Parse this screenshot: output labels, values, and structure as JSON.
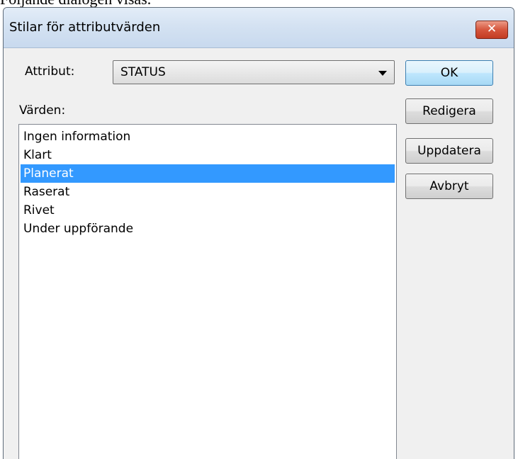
{
  "document_text": "Följande dialogen visas.",
  "dialog": {
    "title": "Stilar för attributvärden",
    "close_glyph": "✕",
    "attribute_label": "Attribut:",
    "attribute_value": "STATUS",
    "values_label": "Värden:",
    "values": [
      {
        "label": "Ingen information",
        "selected": false
      },
      {
        "label": "Klart",
        "selected": false
      },
      {
        "label": "Planerat",
        "selected": true
      },
      {
        "label": "Raserat",
        "selected": false
      },
      {
        "label": "Rivet",
        "selected": false
      },
      {
        "label": "Under uppförande",
        "selected": false
      }
    ],
    "buttons": {
      "ok": "OK",
      "edit": "Redigera",
      "update": "Uppdatera",
      "cancel": "Avbryt"
    }
  },
  "colors": {
    "selection": "#3399ff",
    "close_button": "#c23b22"
  }
}
